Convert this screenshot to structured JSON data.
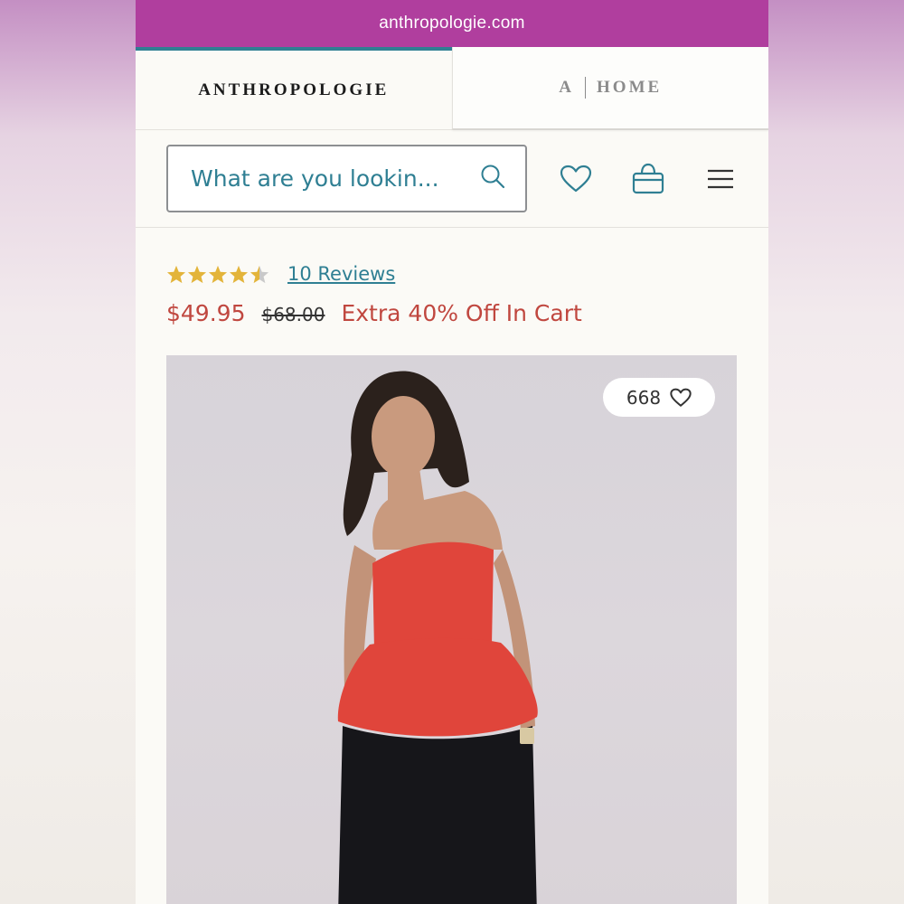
{
  "browser": {
    "url": "anthropologie.com"
  },
  "tabs": [
    {
      "label": "ANTHROPOLOGIE"
    },
    {
      "label_a": "A",
      "label_home": "HOME"
    }
  ],
  "search": {
    "placeholder": "What are you lookin..."
  },
  "header_icons": [
    "heart-icon",
    "shopping-bag-icon",
    "menu-icon"
  ],
  "product": {
    "rating": 4.5,
    "reviews_label": "10 Reviews",
    "price": "$49.95",
    "original_price": "$68.00",
    "promo": "Extra 40% Off In Cart",
    "like_count": "668"
  },
  "colors": {
    "url_bar": "#b03e9e",
    "accent_teal": "#2f7f93",
    "sale_red": "#c0473f",
    "star_gold": "#e3b43a"
  }
}
